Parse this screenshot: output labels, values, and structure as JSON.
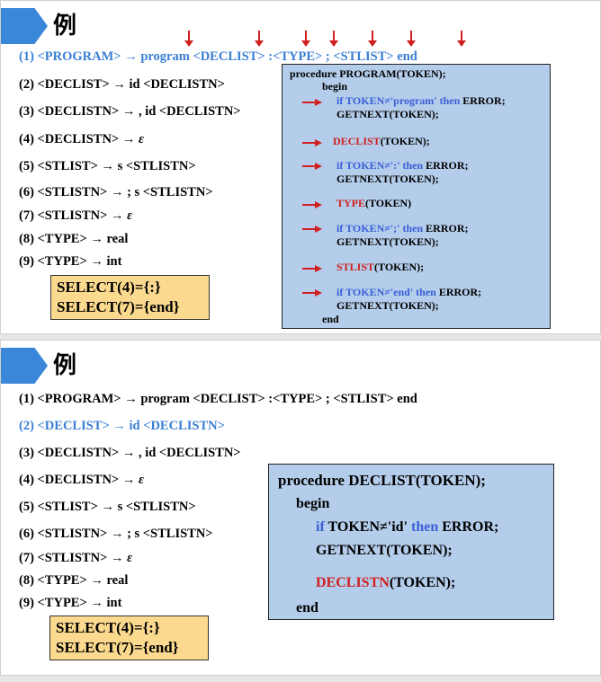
{
  "slide1": {
    "title": "例",
    "rules": [
      "(1) <PROGRAM> → program <DECLIST> :<TYPE> ; <STLIST> end",
      "(2) <DECLIST> → id <DECLISTN>",
      "(3) <DECLISTN> → , id <DECLISTN>",
      "(4) <DECLISTN> → ",
      "(5) <STLIST> → s <STLISTN>",
      "(6) <STLISTN> → ; s <STLISTN>",
      "(7) <STLISTN> → ",
      "(8) <TYPE> → real",
      "(9) <TYPE> → int"
    ],
    "epsilon": "ε",
    "select": [
      "SELECT(4)={:}",
      "SELECT(7)={end}"
    ],
    "proc": {
      "header": "procedure PROGRAM(TOKEN);",
      "begin": "begin",
      "l1a": "if TOKEN≠'program'",
      "l1b": "then",
      "l1c": "ERROR;",
      "l2": "GETNEXT(TOKEN);",
      "l3a": "DECLIST",
      "l3b": "(TOKEN);",
      "l4a": "if TOKEN≠':'",
      "l4b": "then",
      "l4c": "ERROR;",
      "l5": "GETNEXT(TOKEN);",
      "l6a": "TYPE",
      "l6b": "(TOKEN)",
      "l7a": "if TOKEN≠';'",
      "l7b": "then",
      "l7c": "ERROR;",
      "l8": "GETNEXT(TOKEN);",
      "l9a": "STLIST",
      "l9b": "(TOKEN);",
      "l10a": "if TOKEN≠'end'",
      "l10b": "then",
      "l10c": "ERROR;",
      "l11": "GETNEXT(TOKEN);",
      "end": "end"
    },
    "arrow_color": "#d02020",
    "accent_color": "#3a86d8"
  },
  "slide2": {
    "title": "例",
    "rules": [
      "(1) <PROGRAM> → program <DECLIST> :<TYPE> ; <STLIST> end",
      "(2) <DECLIST> → id <DECLISTN>",
      "(3) <DECLISTN> → , id <DECLISTN>",
      "(4) <DECLISTN> → ",
      "(5) <STLIST> → s <STLISTN>",
      "(6) <STLISTN> → ; s <STLISTN>",
      "(7) <STLISTN> → ",
      "(8) <TYPE> → real",
      "(9) <TYPE> → int"
    ],
    "epsilon": "ε",
    "select": [
      "SELECT(4)={:}",
      "SELECT(7)={end}"
    ],
    "proc": {
      "header": "procedure DECLIST(TOKEN);",
      "begin": "begin",
      "l1a": "if",
      "l1b": "TOKEN≠'id'",
      "l1c": "then",
      "l1d": "ERROR;",
      "l2": "GETNEXT(TOKEN);",
      "l3a": "DECLISTN",
      "l3b": "(TOKEN);",
      "end": "end"
    }
  }
}
